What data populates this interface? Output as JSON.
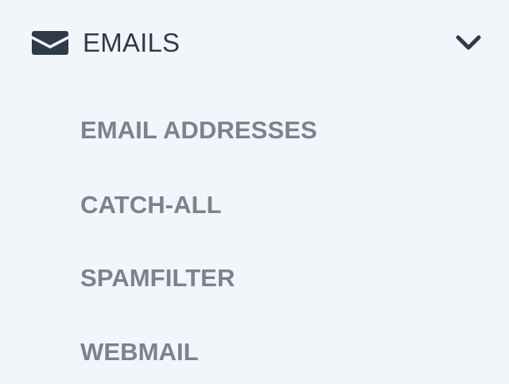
{
  "section": {
    "icon": "envelope-icon",
    "title": "EMAILS",
    "toggle_icon": "chevron-down-icon",
    "color": "#2f3b4a"
  },
  "submenu": {
    "items": [
      {
        "label": "EMAIL ADDRESSES"
      },
      {
        "label": "CATCH-ALL"
      },
      {
        "label": "SPAMFILTER"
      },
      {
        "label": "WEBMAIL"
      }
    ],
    "color": "#7b8290"
  },
  "background": "#f2f5f9"
}
